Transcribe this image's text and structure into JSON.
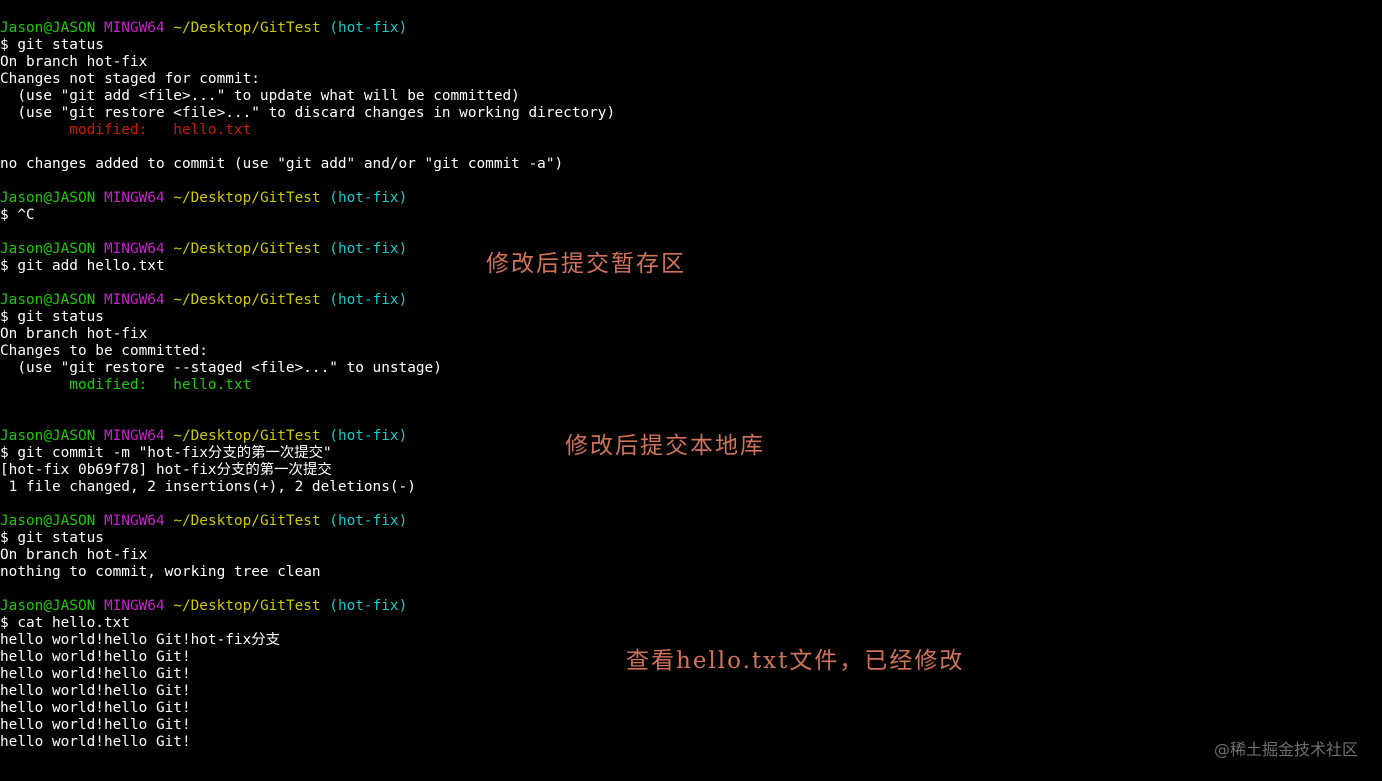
{
  "prompt": {
    "user": "Jason@JASON",
    "host": "MINGW64",
    "path": "~/Desktop/GitTest",
    "branch": "(hot-fix)"
  },
  "lines": [
    {
      "type": "prompt"
    },
    {
      "type": "text",
      "text": "$ git status"
    },
    {
      "type": "text",
      "text": "On branch hot-fix"
    },
    {
      "type": "text",
      "text": "Changes not staged for commit:"
    },
    {
      "type": "text",
      "text": "  (use \"git add <file>...\" to update what will be committed)"
    },
    {
      "type": "text",
      "text": "  (use \"git restore <file>...\" to discard changes in working directory)"
    },
    {
      "type": "text",
      "text": "        modified:   hello.txt",
      "color": "red"
    },
    {
      "type": "blank"
    },
    {
      "type": "text",
      "text": "no changes added to commit (use \"git add\" and/or \"git commit -a\")"
    },
    {
      "type": "blank"
    },
    {
      "type": "prompt"
    },
    {
      "type": "text",
      "text": "$ ^C"
    },
    {
      "type": "blank"
    },
    {
      "type": "prompt"
    },
    {
      "type": "text",
      "text": "$ git add hello.txt"
    },
    {
      "type": "blank"
    },
    {
      "type": "prompt"
    },
    {
      "type": "text",
      "text": "$ git status"
    },
    {
      "type": "text",
      "text": "On branch hot-fix"
    },
    {
      "type": "text",
      "text": "Changes to be committed:"
    },
    {
      "type": "text",
      "text": "  (use \"git restore --staged <file>...\" to unstage)"
    },
    {
      "type": "text",
      "text": "        modified:   hello.txt",
      "color": "green"
    },
    {
      "type": "blank"
    },
    {
      "type": "blank"
    },
    {
      "type": "prompt"
    },
    {
      "type": "text",
      "text": "$ git commit -m \"hot-fix分支的第一次提交\""
    },
    {
      "type": "text",
      "text": "[hot-fix 0b69f78] hot-fix分支的第一次提交"
    },
    {
      "type": "text",
      "text": " 1 file changed, 2 insertions(+), 2 deletions(-)"
    },
    {
      "type": "blank"
    },
    {
      "type": "prompt"
    },
    {
      "type": "text",
      "text": "$ git status"
    },
    {
      "type": "text",
      "text": "On branch hot-fix"
    },
    {
      "type": "text",
      "text": "nothing to commit, working tree clean"
    },
    {
      "type": "blank"
    },
    {
      "type": "prompt"
    },
    {
      "type": "text",
      "text": "$ cat hello.txt"
    },
    {
      "type": "text",
      "text": "hello world!hello Git!hot-fix分支"
    },
    {
      "type": "text",
      "text": "hello world!hello Git!"
    },
    {
      "type": "text",
      "text": "hello world!hello Git!"
    },
    {
      "type": "text",
      "text": "hello world!hello Git!"
    },
    {
      "type": "text",
      "text": "hello world!hello Git!"
    },
    {
      "type": "text",
      "text": "hello world!hello Git!"
    },
    {
      "type": "text",
      "text": "hello world!hello Git!"
    }
  ],
  "annotations": {
    "staging": "修改后提交暂存区",
    "local_repo": "修改后提交本地库",
    "view_file": "查看hello.txt文件，已经修改"
  },
  "watermark": "@稀土掘金技术社区",
  "colors": {
    "background": "#000000",
    "text": "#ffffff",
    "user": "#19cb00",
    "host": "#cb1ed1",
    "path": "#cdcb00",
    "branch": "#0dcdcd",
    "modified_unstaged": "#c91b00",
    "modified_staged": "#19cb00",
    "annotation": "#d1735a"
  }
}
